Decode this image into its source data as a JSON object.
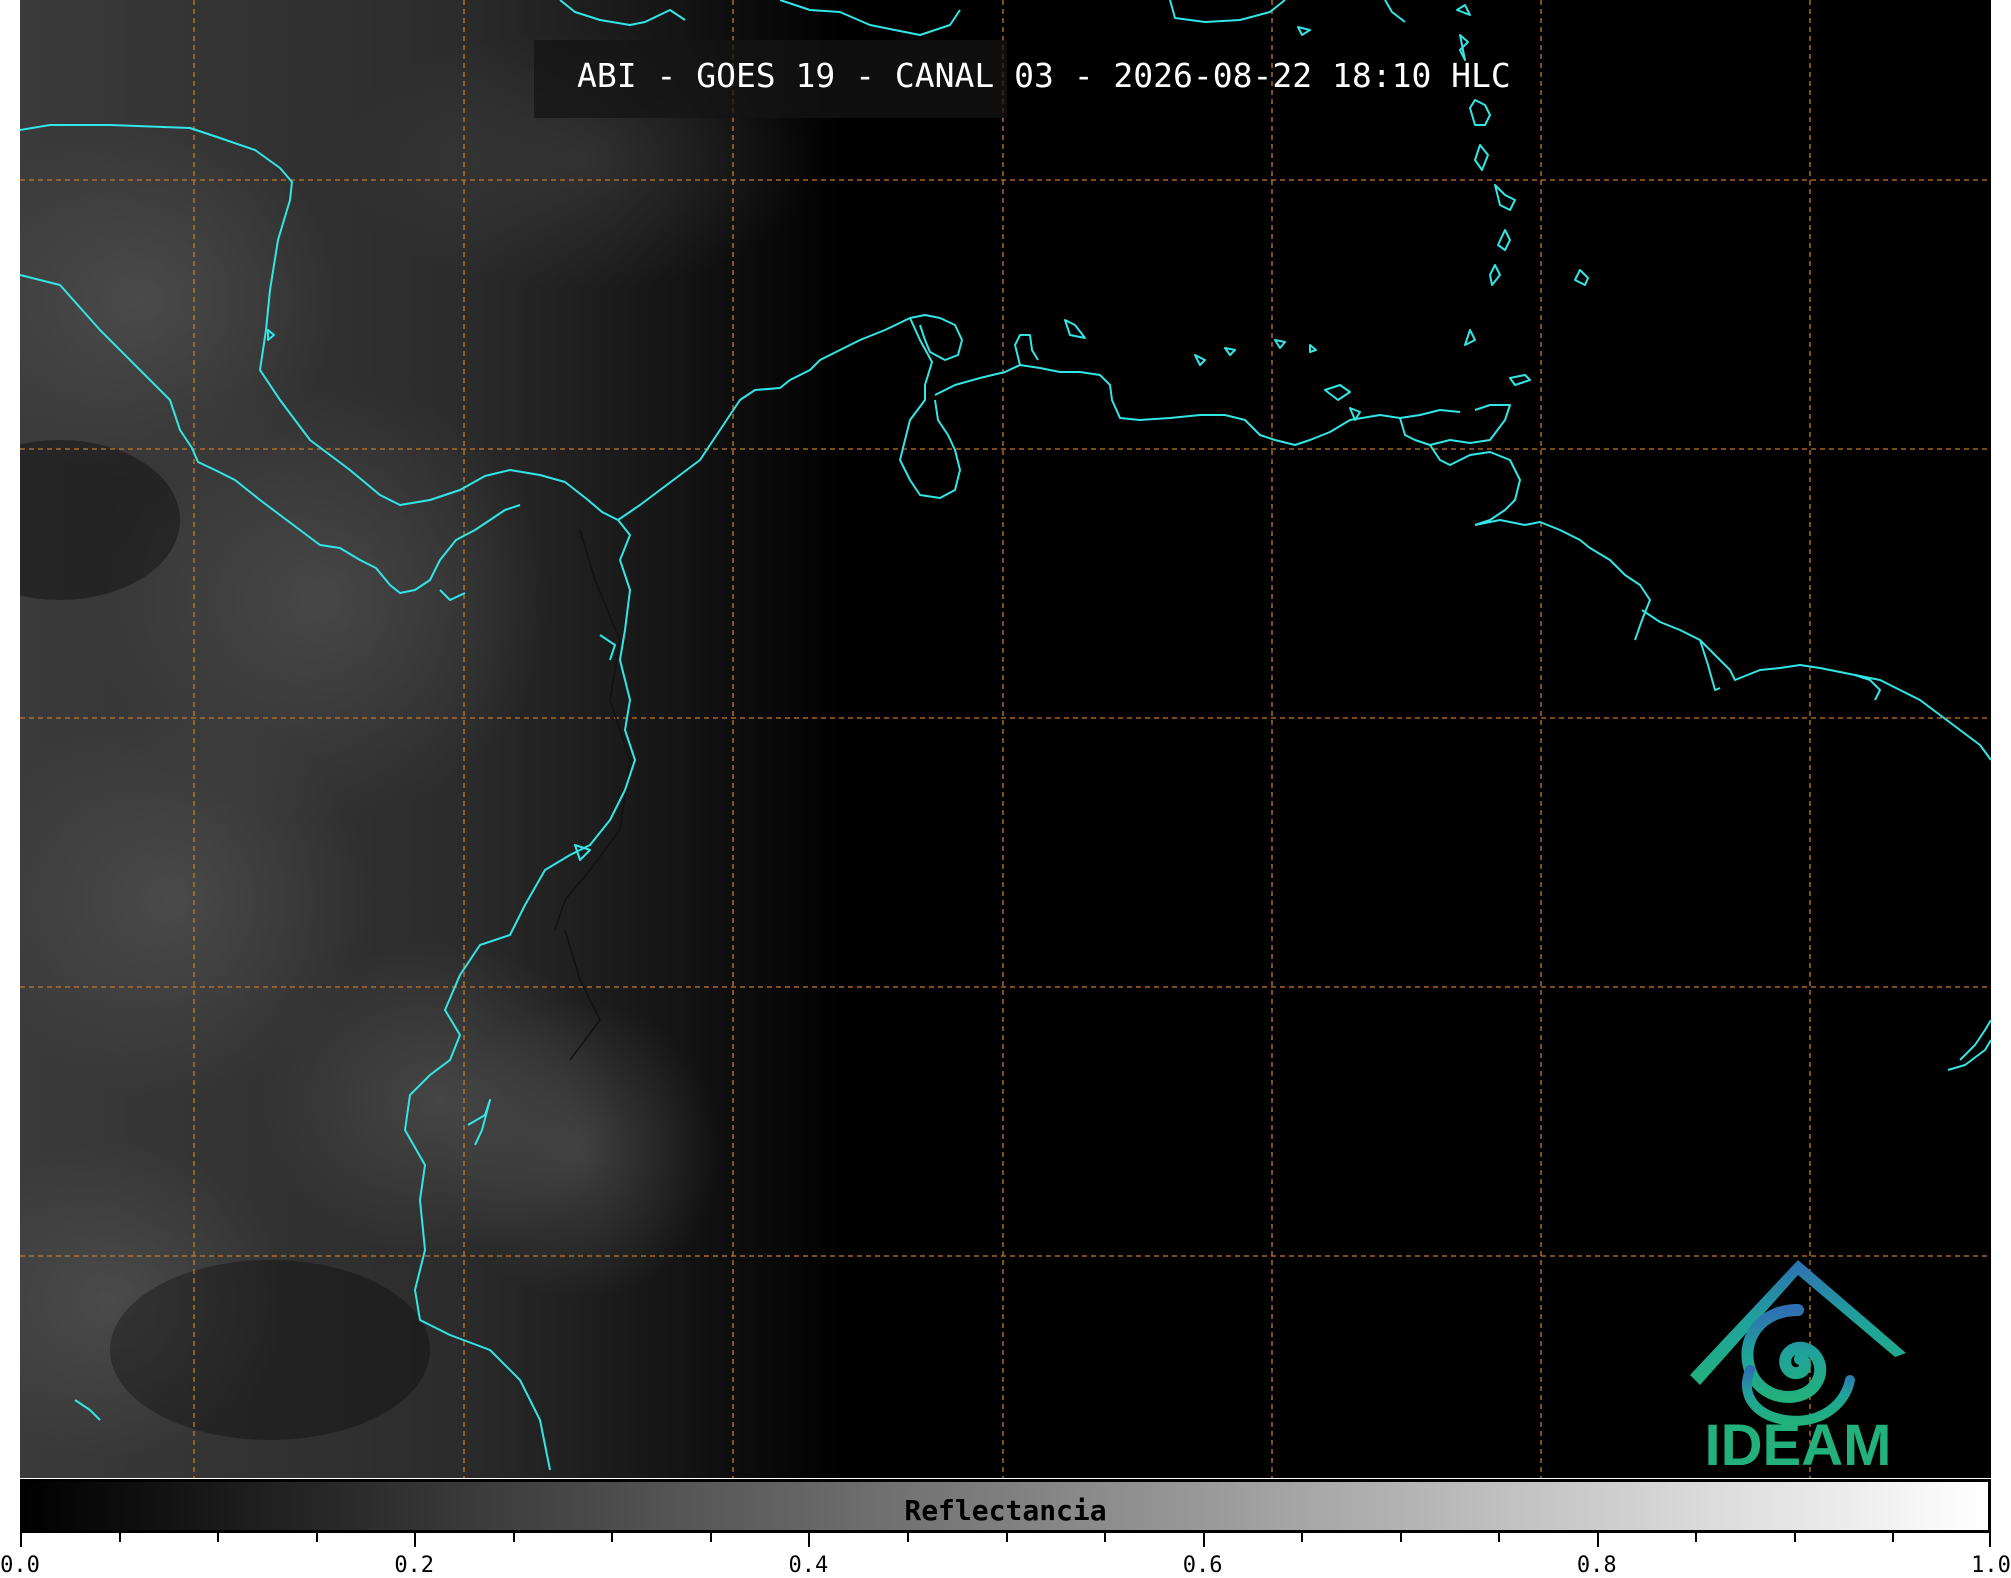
{
  "title": "ABI - GOES 19 - CANAL 03 - 2026-08-22 18:10 HLC",
  "colorbar": {
    "label": "Reflectancia",
    "min": 0.0,
    "max": 1.0,
    "tick_labels": [
      "0.0",
      "0.2",
      "0.4",
      "0.6",
      "0.8",
      "1.0"
    ],
    "colormap": "greys"
  },
  "logo": {
    "text": "IDEAM"
  },
  "colors": {
    "coastline": "#33e6e6",
    "grid": "#c8782a",
    "background": "#000000"
  }
}
